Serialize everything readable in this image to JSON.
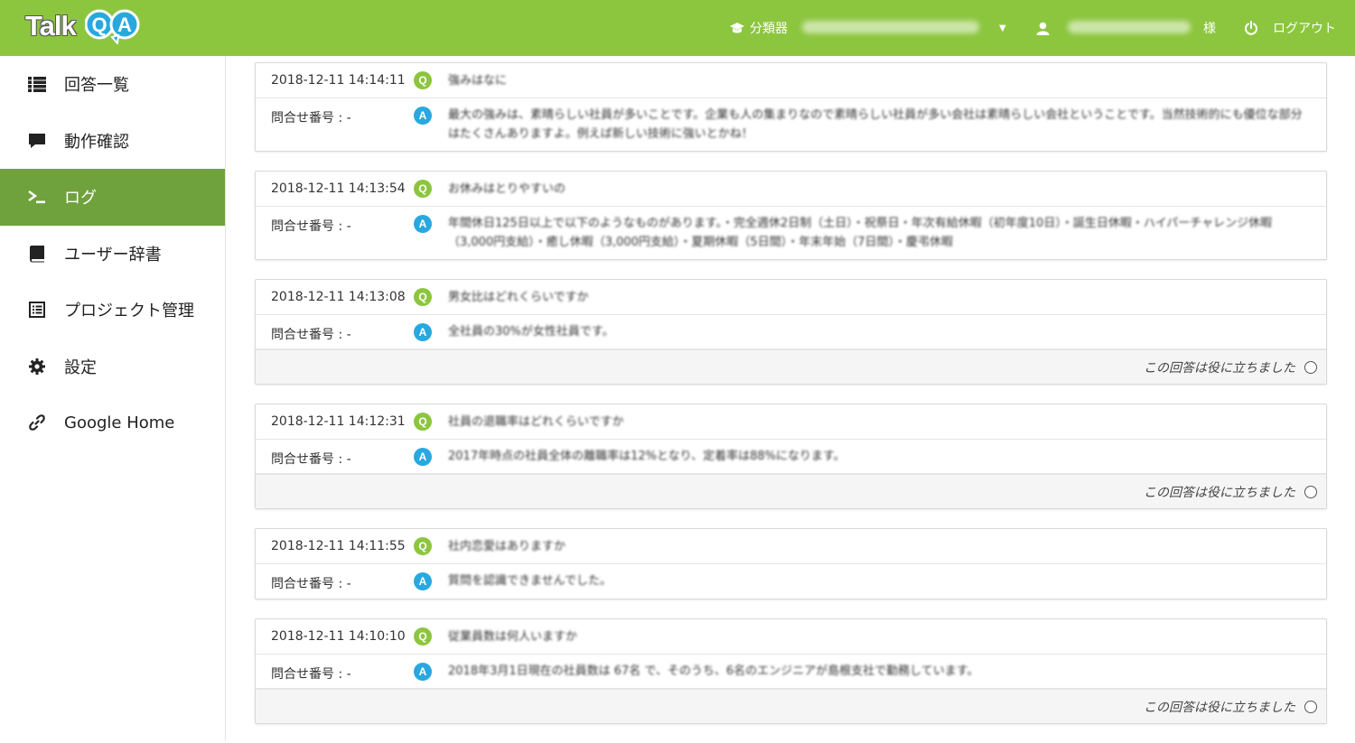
{
  "header": {
    "brand": "TalkQA",
    "brand_talk": "Talk",
    "brand_qa": "QA",
    "classifier_label": "分類器",
    "user_suffix": "様",
    "logout_label": "ログアウト",
    "bg_color": "#8cc63f"
  },
  "sidebar": {
    "active_color": "#6fa23c",
    "items": [
      {
        "label": "回答一覧",
        "icon": "list-icon"
      },
      {
        "label": "動作確認",
        "icon": "comment-icon"
      },
      {
        "label": "ログ",
        "icon": "terminal-icon"
      },
      {
        "label": "ユーザー辞書",
        "icon": "book-icon"
      },
      {
        "label": "プロジェクト管理",
        "icon": "list-alt-icon"
      },
      {
        "label": "設定",
        "icon": "gear-icon"
      },
      {
        "label": "Google Home",
        "icon": "link-icon"
      }
    ]
  },
  "logs": [
    {
      "timestamp": "2018-12-11 14:14:11",
      "question": "強みはなに",
      "inquiry_label": "問合せ番号 : -",
      "answer": "最大の強みは、素晴らしい社員が多いことです。企業も人の集まりなので素晴らしい社員が多い会社は素晴らしい会社ということです。当然技術的にも優位な部分はたくさんありますよ。例えば新しい技術に強いとかね！",
      "feedback": ""
    },
    {
      "timestamp": "2018-12-11 14:13:54",
      "question": "お休みはとりやすいの",
      "inquiry_label": "問合せ番号 : -",
      "answer": "年間休日125日以上で以下のようなものがあります。・完全週休2日制（土日）・祝祭日・年次有給休暇（初年度10日）・誕生日休暇・ハイパーチャレンジ休暇（3,000円支給）・癒し休暇（3,000円支給）・夏期休暇（5日間）・年末年始（7日間）・慶弔休暇",
      "feedback": ""
    },
    {
      "timestamp": "2018-12-11 14:13:08",
      "question": "男女比はどれくらいですか",
      "inquiry_label": "問合せ番号 : -",
      "answer": "全社員の30%が女性社員です。",
      "feedback": "この回答は役に立ちました"
    },
    {
      "timestamp": "2018-12-11 14:12:31",
      "question": "社員の退職率はどれくらいですか",
      "inquiry_label": "問合せ番号 : -",
      "answer": "2017年時点の社員全体の離職率は12%となり、定着率は88%になります。",
      "feedback": "この回答は役に立ちました"
    },
    {
      "timestamp": "2018-12-11 14:11:55",
      "question": "社内恋愛はありますか",
      "inquiry_label": "問合せ番号 : -",
      "answer": "質問を認識できませんでした。",
      "feedback": ""
    },
    {
      "timestamp": "2018-12-11 14:10:10",
      "question": "従業員数は何人いますか",
      "inquiry_label": "問合せ番号 : -",
      "answer": "2018年3月1日現在の社員数は 67名 で、そのうち、6名のエンジニアが島根支社で勤務しています。",
      "feedback": "この回答は役に立ちました"
    }
  ]
}
